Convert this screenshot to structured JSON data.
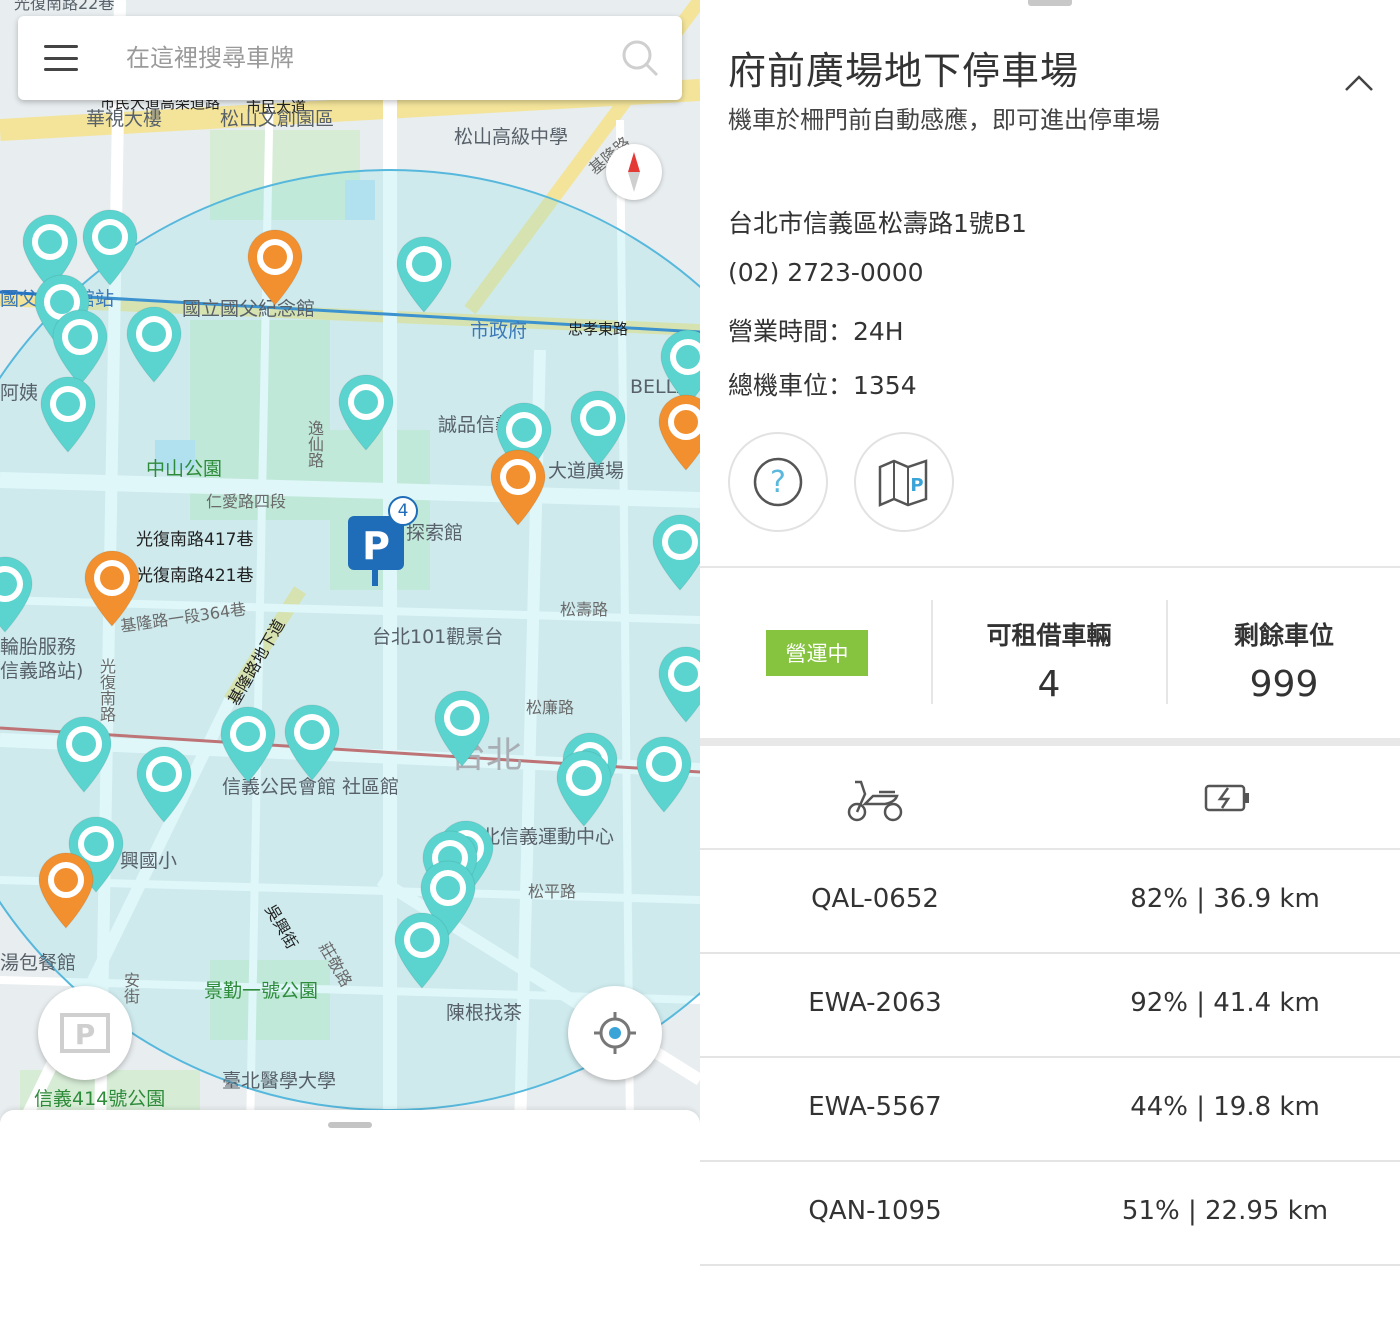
{
  "search": {
    "placeholder": "在這裡搜尋車牌"
  },
  "map": {
    "labels": {
      "l1": "光復南路22巷",
      "l2": "市民大道高架道路",
      "l3": "市民大道",
      "l4": "華視大樓",
      "l5": "松山文創園區",
      "l6": "松山高級中學",
      "l7": "國父紀念館站",
      "l8": "國立國父紀念館",
      "l9": "市政府",
      "l10": "忠孝東路",
      "l11": "BELLA",
      "l12": "阿姨",
      "l13": "中山公園",
      "l14": "逸仙路",
      "l15": "誠品信義",
      "l16": "大道廣場",
      "l17": "仁愛路四段",
      "l18": "光復南路417巷",
      "l19": "光復南路421巷",
      "l20": "探索館",
      "l21": "基隆路一段364巷",
      "l22": "輪胎服務",
      "l23": "信義路站)",
      "l24": "光復南路",
      "l25": "基隆路地下道",
      "l26": "台北101觀景台",
      "l27": "松壽路",
      "l28": "松廉路",
      "l29": "台北",
      "l30": "信義公民會館 社區館",
      "l31": "臺北信義運動中心",
      "l32": "興國小",
      "l33": "吳興街",
      "l34": "莊敬路",
      "l35": "松平路",
      "l36": "湯包餐館",
      "l37": "安街",
      "l38": "景勤一號公園",
      "l39": "陳根找茶",
      "l40": "臺北醫學大學",
      "l41": "信義414號公園",
      "l42": "基隆路"
    },
    "parking_count": "4"
  },
  "station": {
    "name": "府前廣場地下停車場",
    "description": "機車於柵門前自動感應，即可進出停車場",
    "address": "台北市信義區松壽路1號B1",
    "phone": "(02) 2723-0000",
    "hours": "營業時間：24H",
    "total_spaces": "總機車位：1354",
    "status": "營運中",
    "rentable_label": "可租借車輛",
    "rentable_value": "4",
    "remaining_label": "剩餘車位",
    "remaining_value": "999"
  },
  "vehicles": [
    {
      "plate": "QAL-0652",
      "battery": "82% | 36.9 km"
    },
    {
      "plate": "EWA-2063",
      "battery": "92% | 41.4 km"
    },
    {
      "plate": "EWA-5567",
      "battery": "44% | 19.8 km"
    },
    {
      "plate": "QAN-1095",
      "battery": "51% | 22.95 km"
    }
  ],
  "colors": {
    "teal_pin": "#5bd4cf",
    "orange_pin": "#f2902f",
    "parking_blue": "#1f6db8",
    "status_green": "#86c440"
  }
}
